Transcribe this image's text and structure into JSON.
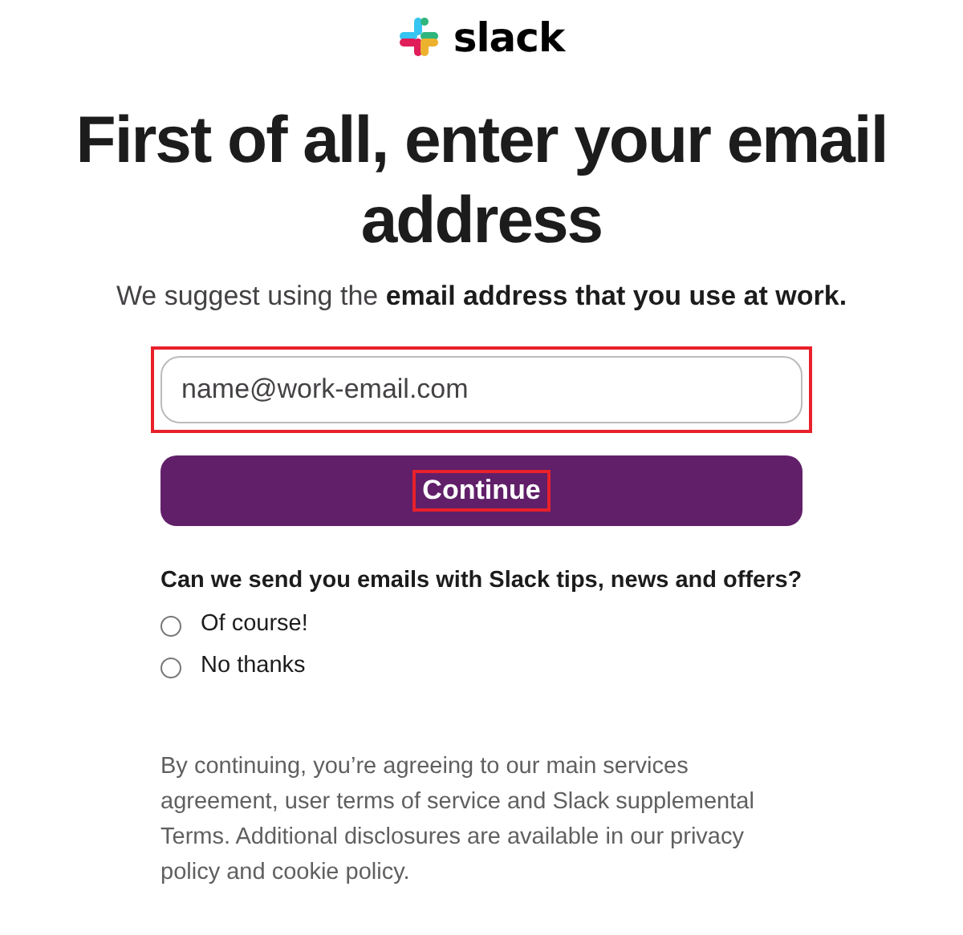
{
  "logo": {
    "wordmark": "slack"
  },
  "heading": "First of all, enter your email address",
  "subtitle": "We suggest using the **email address that you use at work.**",
  "email_field": {
    "placeholder": "name@work-email.com",
    "highlighted": true
  },
  "continue_button": {
    "label": "Continue",
    "highlighted": true
  },
  "marketing_question": "Can we send you emails with Slack tips, news and offers?",
  "options": [
    {
      "label": "Of course!",
      "selected": false
    },
    {
      "label": "No thanks",
      "selected": false
    }
  ],
  "legal_text": "By continuing, you’re agreeing to our main services agreement, user terms of service and Slack supplemental Terms. Additional disclosures are available in our privacy policy and cookie policy."
}
